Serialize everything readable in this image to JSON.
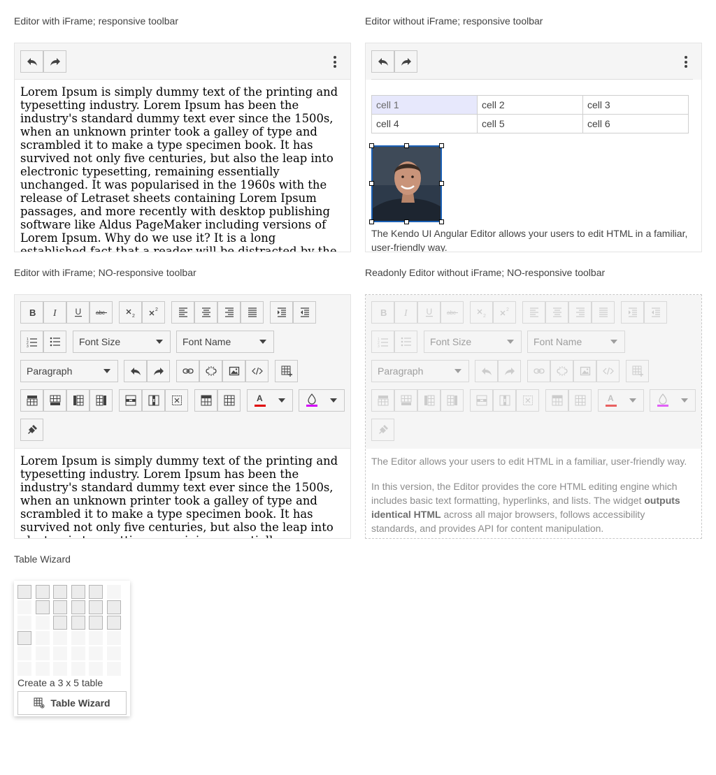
{
  "editor1": {
    "label": "Editor with iFrame; responsive toolbar",
    "text": "Lorem Ipsum is simply dummy text of the printing and typesetting industry. Lorem Ipsum has been the industry's standard dummy text ever since the 1500s, when an unknown printer took a galley of type and scrambled it to make a type specimen book. It has survived not only five centuries, but also the leap into electronic typesetting, remaining essentially unchanged. It was popularised in the 1960s with the release of Letraset sheets containing Lorem Ipsum passages, and more recently with desktop publishing software like Aldus PageMaker including versions of Lorem Ipsum. Why do we use it? It is a long established fact that a reader will be distracted by the readable content of a page when looking at its layout."
  },
  "editor2": {
    "label": "Editor without iFrame; responsive toolbar",
    "table": [
      [
        "cell 1",
        "cell 2",
        "cell 3"
      ],
      [
        "cell 4",
        "cell 5",
        "cell 6"
      ]
    ],
    "image_alt": "person photo",
    "text": "The Kendo UI Angular Editor allows your users to edit HTML in a familiar, user-friendly way."
  },
  "editor3": {
    "label": "Editor with iFrame; NO-responsive toolbar",
    "font_size_placeholder": "Font Size",
    "font_name_placeholder": "Font Name",
    "format_value": "Paragraph",
    "text": "Lorem Ipsum is simply dummy text of the printing and typesetting industry. Lorem Ipsum has been the industry's standard dummy text ever since the 1500s, when an unknown printer took a galley of type and scrambled it to make a type specimen book. It has survived not only five centuries, but also the leap into electronic typesetting, remaining essentially unchanged."
  },
  "editor4": {
    "label": "Readonly Editor without iFrame; NO-responsive toolbar",
    "font_size_placeholder": "Font Size",
    "font_name_placeholder": "Font Name",
    "format_value": "Paragraph",
    "para1": "The Editor allows your users to edit HTML in a familiar, user-friendly way.",
    "para2_start": "In this version, the Editor provides the core HTML editing engine which includes basic text formatting, hyperlinks, and lists. The widget ",
    "para2_bold": "outputs identical HTML",
    "para2_end": " across all major browsers, follows accessibility standards, and provides API for content manipulation."
  },
  "wizard": {
    "label": "Table Wizard",
    "status": "Create a 3 x 5 table",
    "button_label": "Table Wizard",
    "selected_rows": 3,
    "selected_cols": 5
  },
  "colors": {
    "toolbar_bg": "#f5f5f5",
    "text_color_swatch": "#e00000",
    "background_color_swatch": "#d500f9",
    "selected_cell": "#e7e8fc",
    "image_border": "#1a5fb4"
  }
}
